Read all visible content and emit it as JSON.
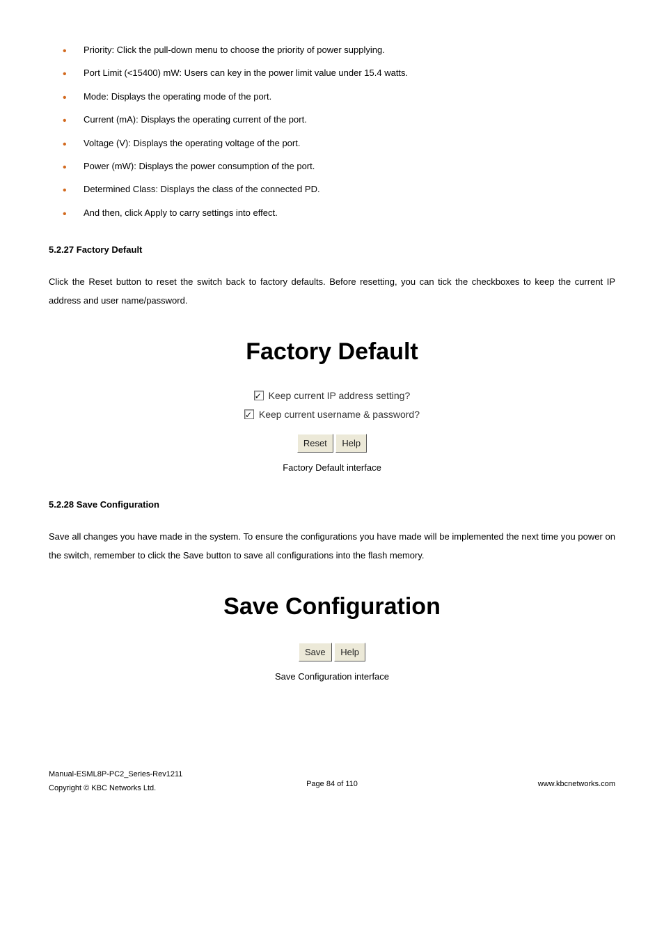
{
  "bullets": [
    "Priority: Click the pull-down menu to choose the priority of power supplying.",
    "Port Limit (<15400) mW: Users can key in the power limit value under 15.4 watts.",
    "Mode: Displays the operating mode of the port.",
    "Current (mA): Displays the operating current of the port.",
    "Voltage (V): Displays the operating voltage of the port.",
    "Power (mW): Displays the power consumption of the port.",
    "Determined Class: Displays the class of the connected PD.",
    "And then, click Apply to carry settings into effect."
  ],
  "sec1": {
    "heading": "5.2.27 Factory Default",
    "body": "Click the Reset button to reset the switch back to factory defaults. Before resetting, you can tick the checkboxes to keep the current IP address and user name/password.",
    "title": "Factory Default",
    "check1": "Keep current IP address setting?",
    "check2": "Keep current username & password?",
    "btn_reset": "Reset",
    "btn_help": "Help",
    "caption": "Factory Default interface"
  },
  "sec2": {
    "heading": "5.2.28 Save Configuration",
    "body": "Save all changes you have made in the system. To ensure the configurations you have made will be implemented the next time you power on the switch, remember to click the Save button to save all configurations into the flash memory.",
    "title": "Save Configuration",
    "btn_save": "Save",
    "btn_help": "Help",
    "caption": "Save Configuration interface"
  },
  "footer": {
    "line1": "Manual-ESML8P-PC2_Series-Rev1211",
    "line2": "Copyright © KBC Networks Ltd.",
    "center": "Page 84 of 110",
    "right": "www.kbcnetworks.com"
  }
}
